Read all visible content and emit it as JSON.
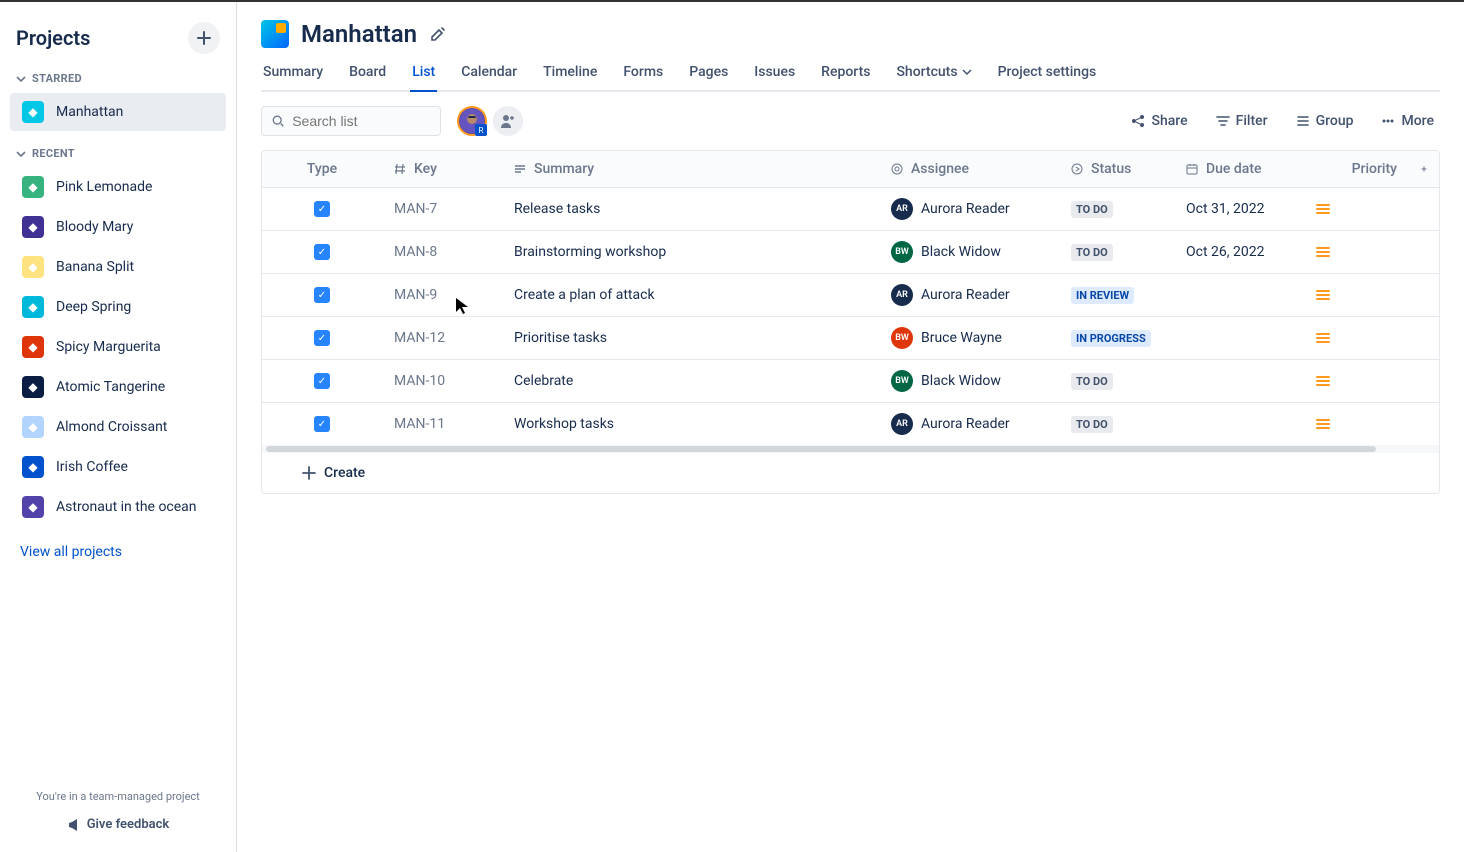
{
  "sidebar": {
    "title": "Projects",
    "sections": {
      "starred": {
        "label": "STARRED",
        "items": [
          {
            "name": "Manhattan",
            "color": "#00C7E6"
          }
        ]
      },
      "recent": {
        "label": "RECENT",
        "items": [
          {
            "name": "Pink Lemonade",
            "color": "#36B37E"
          },
          {
            "name": "Bloody Mary",
            "color": "#403294"
          },
          {
            "name": "Banana Split",
            "color": "#FFE380"
          },
          {
            "name": "Deep Spring",
            "color": "#00B8D9"
          },
          {
            "name": "Spicy Marguerita",
            "color": "#DE350B"
          },
          {
            "name": "Atomic Tangerine",
            "color": "#091E42"
          },
          {
            "name": "Almond Croissant",
            "color": "#B3D4FF"
          },
          {
            "name": "Irish Coffee",
            "color": "#0052CC"
          },
          {
            "name": "Astronaut in the ocean",
            "color": "#5243AA"
          }
        ]
      }
    },
    "view_all": "View all projects",
    "footer_note": "You're in a team-managed project",
    "feedback": "Give feedback"
  },
  "project": {
    "title": "Manhattan"
  },
  "tabs": [
    {
      "label": "Summary"
    },
    {
      "label": "Board"
    },
    {
      "label": "List",
      "active": true
    },
    {
      "label": "Calendar"
    },
    {
      "label": "Timeline"
    },
    {
      "label": "Forms"
    },
    {
      "label": "Pages"
    },
    {
      "label": "Issues"
    },
    {
      "label": "Reports"
    },
    {
      "label": "Shortcuts",
      "dropdown": true
    },
    {
      "label": "Project settings"
    }
  ],
  "toolbar": {
    "search_placeholder": "Search list",
    "share": "Share",
    "filter": "Filter",
    "group": "Group",
    "more": "More"
  },
  "columns": {
    "type": "Type",
    "key": "Key",
    "summary": "Summary",
    "assignee": "Assignee",
    "status": "Status",
    "due": "Due date",
    "priority": "Priority"
  },
  "rows": [
    {
      "key": "MAN-7",
      "summary": "Release tasks",
      "assignee": {
        "name": "Aurora Reader",
        "initials": "AR",
        "color": "#172B4D"
      },
      "status": "TO DO",
      "status_kind": "todo",
      "due": "Oct 31, 2022"
    },
    {
      "key": "MAN-8",
      "summary": "Brainstorming workshop",
      "assignee": {
        "name": "Black Widow",
        "initials": "BW",
        "color": "#006644"
      },
      "status": "TO DO",
      "status_kind": "todo",
      "due": "Oct 26, 2022"
    },
    {
      "key": "MAN-9",
      "summary": "Create a plan of attack",
      "assignee": {
        "name": "Aurora Reader",
        "initials": "AR",
        "color": "#172B4D"
      },
      "status": "IN REVIEW",
      "status_kind": "review",
      "due": ""
    },
    {
      "key": "MAN-12",
      "summary": "Prioritise tasks",
      "assignee": {
        "name": "Bruce Wayne",
        "initials": "BW",
        "color": "#DE350B"
      },
      "status": "IN PROGRESS",
      "status_kind": "progress",
      "due": ""
    },
    {
      "key": "MAN-10",
      "summary": "Celebrate",
      "assignee": {
        "name": "Black Widow",
        "initials": "BW",
        "color": "#006644"
      },
      "status": "TO DO",
      "status_kind": "todo",
      "due": ""
    },
    {
      "key": "MAN-11",
      "summary": "Workshop tasks",
      "assignee": {
        "name": "Aurora Reader",
        "initials": "AR",
        "color": "#172B4D"
      },
      "status": "TO DO",
      "status_kind": "todo",
      "due": ""
    }
  ],
  "create_label": "Create"
}
